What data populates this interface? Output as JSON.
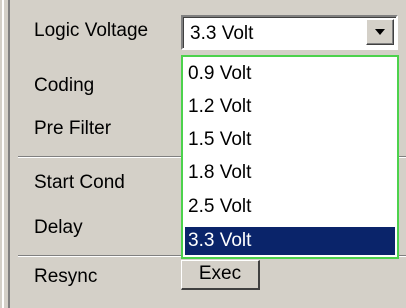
{
  "labels": {
    "logic_voltage": "Logic Voltage",
    "coding": "Coding",
    "pre_filter": "Pre Filter",
    "start_cond": "Start Cond",
    "delay": "Delay",
    "resync": "Resync"
  },
  "logic_voltage_combo": {
    "selected": "3.3 Volt",
    "options": [
      "0.9 Volt",
      "1.2 Volt",
      "1.5 Volt",
      "1.8 Volt",
      "2.5 Volt",
      "3.3 Volt"
    ],
    "highlighted_option": "3.3 Volt",
    "dropdown_icon": "chevron-down-icon"
  },
  "resync_button": {
    "label": "Exec"
  },
  "colors": {
    "panel_bg": "#d4d0c8",
    "selection_bg": "#0a246a",
    "focus_border": "#4cd24c"
  }
}
